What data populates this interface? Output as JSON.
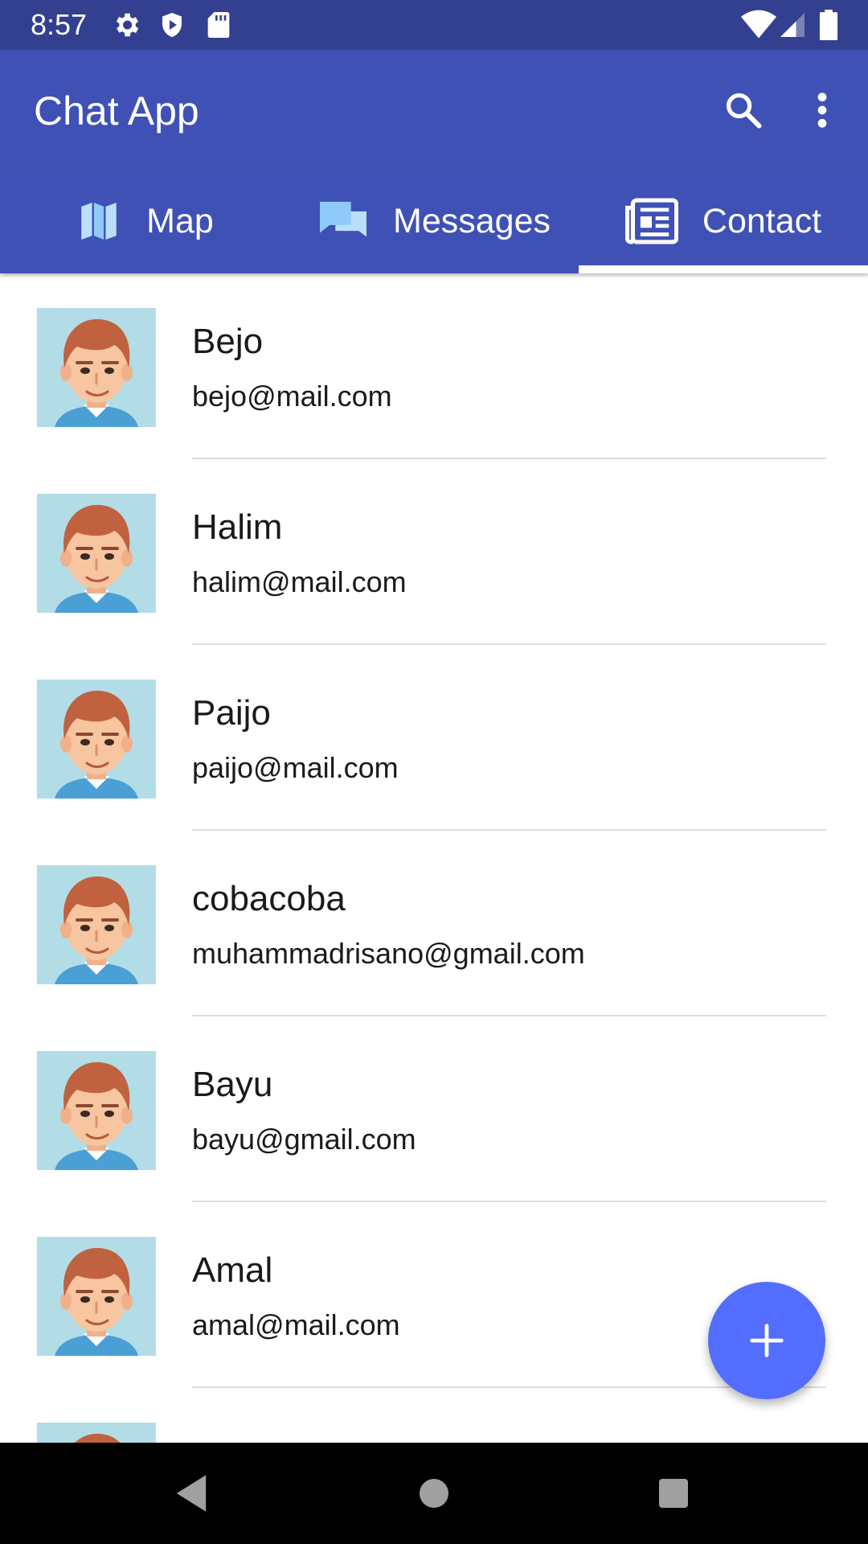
{
  "status_bar": {
    "time": "8:57",
    "left_icons": [
      "gear-icon",
      "shield-play-icon",
      "sd-card-icon"
    ],
    "right_icons": [
      "wifi-icon",
      "signal-icon",
      "battery-icon"
    ]
  },
  "app_bar": {
    "title": "Chat App",
    "actions": [
      "search-icon",
      "overflow-menu-icon"
    ]
  },
  "tabs": [
    {
      "label": "Map",
      "icon": "map-icon",
      "selected": false
    },
    {
      "label": "Messages",
      "icon": "chat-icon",
      "selected": false
    },
    {
      "label": "Contact",
      "icon": "contact-card-icon",
      "selected": true
    }
  ],
  "contacts": [
    {
      "name": "Bejo",
      "email": "bejo@mail.com"
    },
    {
      "name": "Halim",
      "email": "halim@mail.com"
    },
    {
      "name": "Paijo",
      "email": "paijo@mail.com"
    },
    {
      "name": "cobacoba",
      "email": "muhammadrisano@gmail.com"
    },
    {
      "name": "Bayu",
      "email": "bayu@gmail.com"
    },
    {
      "name": "Amal",
      "email": "amal@mail.com"
    }
  ],
  "fab": {
    "icon": "plus-icon"
  },
  "nav_bar": {
    "buttons": [
      "back-icon",
      "home-icon",
      "recents-icon"
    ]
  },
  "colors": {
    "status_bar": "#33408f",
    "primary": "#3f51b5",
    "fab": "#536dfe",
    "avatar_bg": "#b2dde6",
    "tab_indicator": "#ffffff"
  }
}
